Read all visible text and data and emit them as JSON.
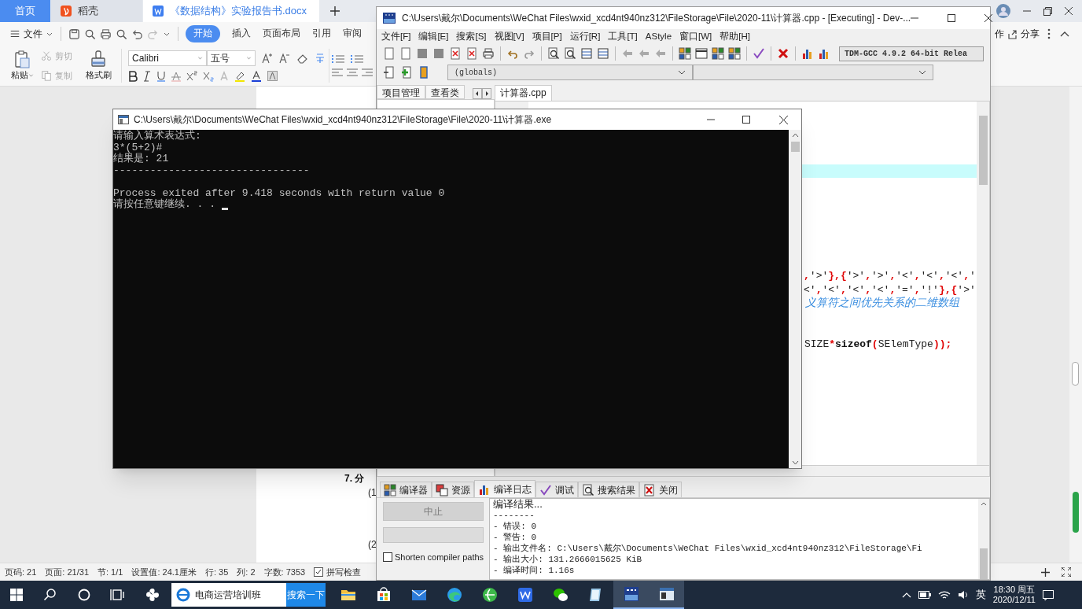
{
  "wps": {
    "tabs": [
      {
        "label": "首页",
        "selected": false,
        "kind": "home"
      },
      {
        "label": "稻壳",
        "selected": false,
        "kind": "app"
      },
      {
        "label": "《数据结构》实验报告书.docx",
        "selected": true,
        "kind": "doc"
      }
    ],
    "file_menu": "文件",
    "ribbon_tabs": [
      {
        "label": "开始",
        "selected": true
      },
      {
        "label": "插入",
        "selected": false
      },
      {
        "label": "页面布局",
        "selected": false
      },
      {
        "label": "引用",
        "selected": false
      },
      {
        "label": "审阅",
        "selected": false
      }
    ],
    "collab": "作",
    "share": "分享",
    "paste": "粘贴",
    "cut": {
      "label": "剪切",
      "disabled": true
    },
    "copy": {
      "label": "复制",
      "disabled": true
    },
    "format_painter": "格式刷",
    "font": "Calibri",
    "font_size": "五号",
    "document_lines": [
      "7. 分",
      "(1",
      "(2"
    ],
    "status_bar": [
      "页码: 21",
      "页面: 21/31",
      "节: 1/1",
      "设置值: 24.1厘米",
      "行: 35",
      "列: 2",
      "字数: 7353"
    ],
    "spell_check": "拼写检查"
  },
  "devcpp": {
    "title": "C:\\Users\\戴尔\\Documents\\WeChat Files\\wxid_xcd4nt940nz312\\FileStorage\\File\\2020-11\\计算器.cpp - [Executing] - Dev-...",
    "menu": [
      "文件[F]",
      "编辑[E]",
      "搜索[S]",
      "视图[V]",
      "项目[P]",
      "运行[R]",
      "工具[T]",
      "AStyle",
      "窗口[W]",
      "帮助[H]"
    ],
    "compiler": "TDM-GCC 4.9.2 64-bit Relea",
    "scope": "(globals)",
    "panel_tabs": [
      "项目管理",
      "查看类"
    ],
    "editor_tab": "计算器.cpp",
    "code": [
      {
        "kind": "current"
      },
      {
        "kind": "chars",
        "text": ",'>'},{'>','>','<','<','<','"
      },
      {
        "kind": "chars",
        "text": "<','<','<','<','=','!'},{'>'"
      },
      {
        "kind": "comment",
        "text": "义算符之间优先关系的二维数组"
      },
      {
        "kind": "call",
        "text": "SIZE*sizeof(SElemType));"
      }
    ],
    "bottom_tabs": [
      {
        "label": "编译器",
        "selected": false
      },
      {
        "label": "资源",
        "selected": false
      },
      {
        "label": "编译日志",
        "selected": true
      },
      {
        "label": "调试",
        "selected": false
      },
      {
        "label": "搜索结果",
        "selected": false
      },
      {
        "label": "关闭",
        "selected": false
      }
    ],
    "abort_button": {
      "label": "中止",
      "disabled": true
    },
    "shorten_paths": {
      "label": "Shorten compiler paths",
      "checked": false
    },
    "log": [
      "编译结果...",
      "--------",
      "- 错误: 0",
      "- 警告: 0",
      "- 输出文件名: C:\\Users\\戴尔\\Documents\\WeChat Files\\wxid_xcd4nt940nz312\\FileStorage\\Fi",
      "- 输出大小: 131.2666015625 KiB",
      "- 编译时间: 1.16s"
    ]
  },
  "console": {
    "title": "C:\\Users\\戴尔\\Documents\\WeChat Files\\wxid_xcd4nt940nz312\\FileStorage\\File\\2020-11\\计算器.exe",
    "lines": [
      {
        "kind": "text",
        "text": "请输入算术表达式:"
      },
      {
        "kind": "text",
        "text": "3*(5+2)#"
      },
      {
        "kind": "text",
        "text": "结果是: 21"
      },
      {
        "kind": "text",
        "text": "--------------------------------"
      },
      {
        "kind": "blank"
      },
      {
        "kind": "text",
        "text": "Process exited after 9.418 seconds with return value 0"
      },
      {
        "kind": "text",
        "text": "请按任意键继续. . ."
      }
    ],
    "cursor": true
  },
  "taskbar": {
    "search_text": "电商运营培训班",
    "search_button": "搜索一下",
    "apps": [
      {
        "kind": "folder",
        "active": false
      },
      {
        "kind": "store",
        "active": false
      },
      {
        "kind": "mail",
        "active": false
      },
      {
        "kind": "edge",
        "active": false
      },
      {
        "kind": "browser",
        "active": false
      },
      {
        "kind": "wps",
        "active": false
      },
      {
        "kind": "chat",
        "active": false
      },
      {
        "kind": "notebook",
        "active": false
      },
      {
        "kind": "dev",
        "active": true
      },
      {
        "kind": "console",
        "active": true
      }
    ],
    "ime": "英",
    "time": "18:30 周五",
    "date": "2020/12/11"
  }
}
